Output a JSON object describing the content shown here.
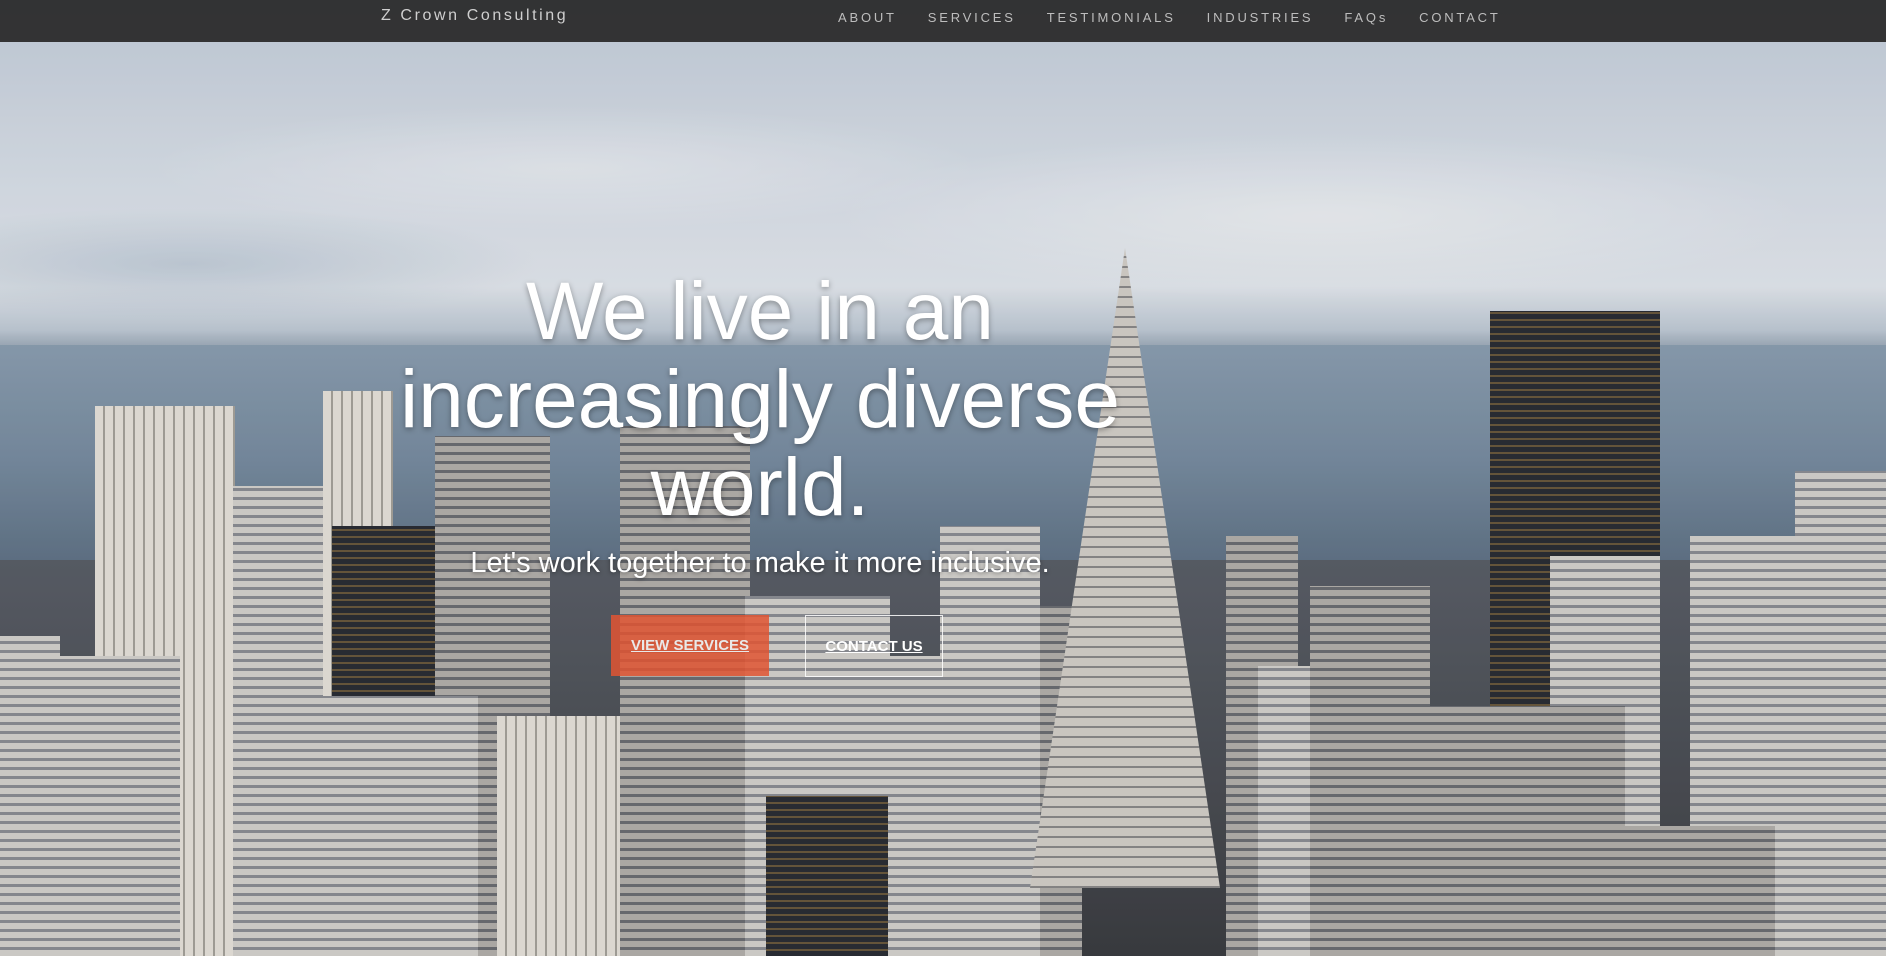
{
  "nav": {
    "brand": "Z Crown Consulting",
    "links": [
      "ABOUT",
      "SERVICES",
      "TESTIMONIALS",
      "INDUSTRIES",
      "FAQs",
      "CONTACT"
    ]
  },
  "hero": {
    "headline_lines": [
      "We live in an",
      "increasingly diverse",
      "world."
    ],
    "subheadline": "Let's work together to make it more inclusive.",
    "primary_button": "VIEW SERVICES",
    "secondary_button": "CONTACT US"
  },
  "colors": {
    "navbar": "#282828",
    "primary_button": "#e15532",
    "text": "#ffffff"
  }
}
